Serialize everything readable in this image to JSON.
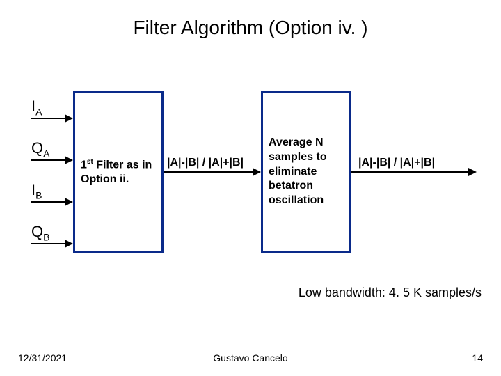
{
  "title": "Filter Algorithm (Option iv. )",
  "inputs": {
    "ia": "I",
    "ia_sub": "A",
    "qa": "Q",
    "qa_sub": "A",
    "ib": "I",
    "ib_sub": "B",
    "qb": "Q",
    "qb_sub": "B"
  },
  "box1_line1": "1",
  "box1_sup": "st",
  "box1_rest": " Filter as in Option ii.",
  "mid_label": "|A|-|B| / |A|+|B|",
  "box2_text": "Average N samples to eliminate betatron oscillation",
  "out_label": "|A|-|B| / |A|+|B|",
  "bandwidth": "Low bandwidth: 4. 5 K samples/s",
  "footer": {
    "date": "12/31/2021",
    "author": "Gustavo Cancelo",
    "page": "14"
  }
}
